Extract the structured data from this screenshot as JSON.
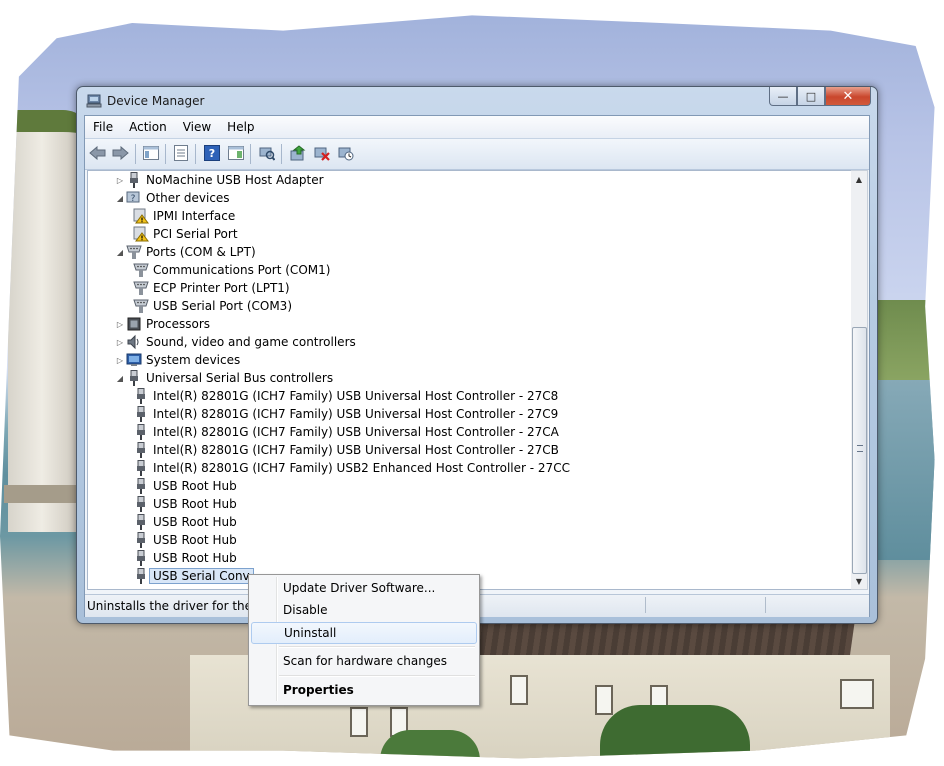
{
  "window": {
    "title": "Device Manager",
    "buttons": {
      "minimize": "—",
      "maximize": "□",
      "close": "✕"
    }
  },
  "menubar": [
    "File",
    "Action",
    "View",
    "Help"
  ],
  "toolbar": [
    "back-icon",
    "forward-icon",
    "console-tree-icon",
    "properties-icon",
    "help-icon",
    "view-icon",
    "scan-hardware-icon",
    "update-driver-icon",
    "uninstall-icon",
    "disable-icon"
  ],
  "tree": [
    {
      "label": "NoMachine USB Host Adapter",
      "level": 0,
      "expander": "▷",
      "icon": "usb-plug-icon"
    },
    {
      "label": "Other devices",
      "level": 0,
      "expander": "◢",
      "icon": "unknown-device-icon"
    },
    {
      "label": "IPMI Interface",
      "level": 1,
      "expander": "",
      "icon": "warning-device-icon"
    },
    {
      "label": "PCI Serial Port",
      "level": 1,
      "expander": "",
      "icon": "warning-device-icon"
    },
    {
      "label": "Ports (COM & LPT)",
      "level": 0,
      "expander": "◢",
      "icon": "port-icon"
    },
    {
      "label": "Communications Port (COM1)",
      "level": 1,
      "expander": "",
      "icon": "port-icon"
    },
    {
      "label": "ECP Printer Port (LPT1)",
      "level": 1,
      "expander": "",
      "icon": "port-icon"
    },
    {
      "label": "USB Serial Port (COM3)",
      "level": 1,
      "expander": "",
      "icon": "port-icon"
    },
    {
      "label": "Processors",
      "level": 0,
      "expander": "▷",
      "icon": "processor-icon"
    },
    {
      "label": "Sound, video and game controllers",
      "level": 0,
      "expander": "▷",
      "icon": "speaker-icon"
    },
    {
      "label": "System devices",
      "level": 0,
      "expander": "▷",
      "icon": "system-icon"
    },
    {
      "label": "Universal Serial Bus controllers",
      "level": 0,
      "expander": "◢",
      "icon": "usb-plug-icon"
    },
    {
      "label": "Intel(R) 82801G (ICH7 Family) USB Universal Host Controller - 27C8",
      "level": 1,
      "expander": "",
      "icon": "usb-plug-icon"
    },
    {
      "label": "Intel(R) 82801G (ICH7 Family) USB Universal Host Controller - 27C9",
      "level": 1,
      "expander": "",
      "icon": "usb-plug-icon"
    },
    {
      "label": "Intel(R) 82801G (ICH7 Family) USB Universal Host Controller - 27CA",
      "level": 1,
      "expander": "",
      "icon": "usb-plug-icon"
    },
    {
      "label": "Intel(R) 82801G (ICH7 Family) USB Universal Host Controller - 27CB",
      "level": 1,
      "expander": "",
      "icon": "usb-plug-icon"
    },
    {
      "label": "Intel(R) 82801G (ICH7 Family) USB2 Enhanced Host Controller - 27CC",
      "level": 1,
      "expander": "",
      "icon": "usb-plug-icon"
    },
    {
      "label": "USB Root Hub",
      "level": 1,
      "expander": "",
      "icon": "usb-plug-icon"
    },
    {
      "label": "USB Root Hub",
      "level": 1,
      "expander": "",
      "icon": "usb-plug-icon"
    },
    {
      "label": "USB Root Hub",
      "level": 1,
      "expander": "",
      "icon": "usb-plug-icon"
    },
    {
      "label": "USB Root Hub",
      "level": 1,
      "expander": "",
      "icon": "usb-plug-icon"
    },
    {
      "label": "USB Root Hub",
      "level": 1,
      "expander": "",
      "icon": "usb-plug-icon"
    },
    {
      "label": "USB Serial Conv",
      "level": 1,
      "expander": "",
      "icon": "usb-plug-icon",
      "selected": true
    }
  ],
  "status": {
    "text": "Uninstalls the driver for the sele"
  },
  "context_menu": {
    "items": [
      {
        "label": "Update Driver Software...",
        "highlighted": false,
        "bold": false
      },
      {
        "label": "Disable",
        "highlighted": false,
        "bold": false
      },
      {
        "label": "Uninstall",
        "highlighted": true,
        "bold": false
      },
      {
        "separator": true
      },
      {
        "label": "Scan for hardware changes",
        "highlighted": false,
        "bold": false
      },
      {
        "separator": true
      },
      {
        "label": "Properties",
        "highlighted": false,
        "bold": true
      }
    ]
  },
  "colors": {
    "selection_border": "#7da2ce",
    "selection_fill": "#d8e6f7",
    "close_button": "#c9472d",
    "warning": "#f2c21b"
  }
}
